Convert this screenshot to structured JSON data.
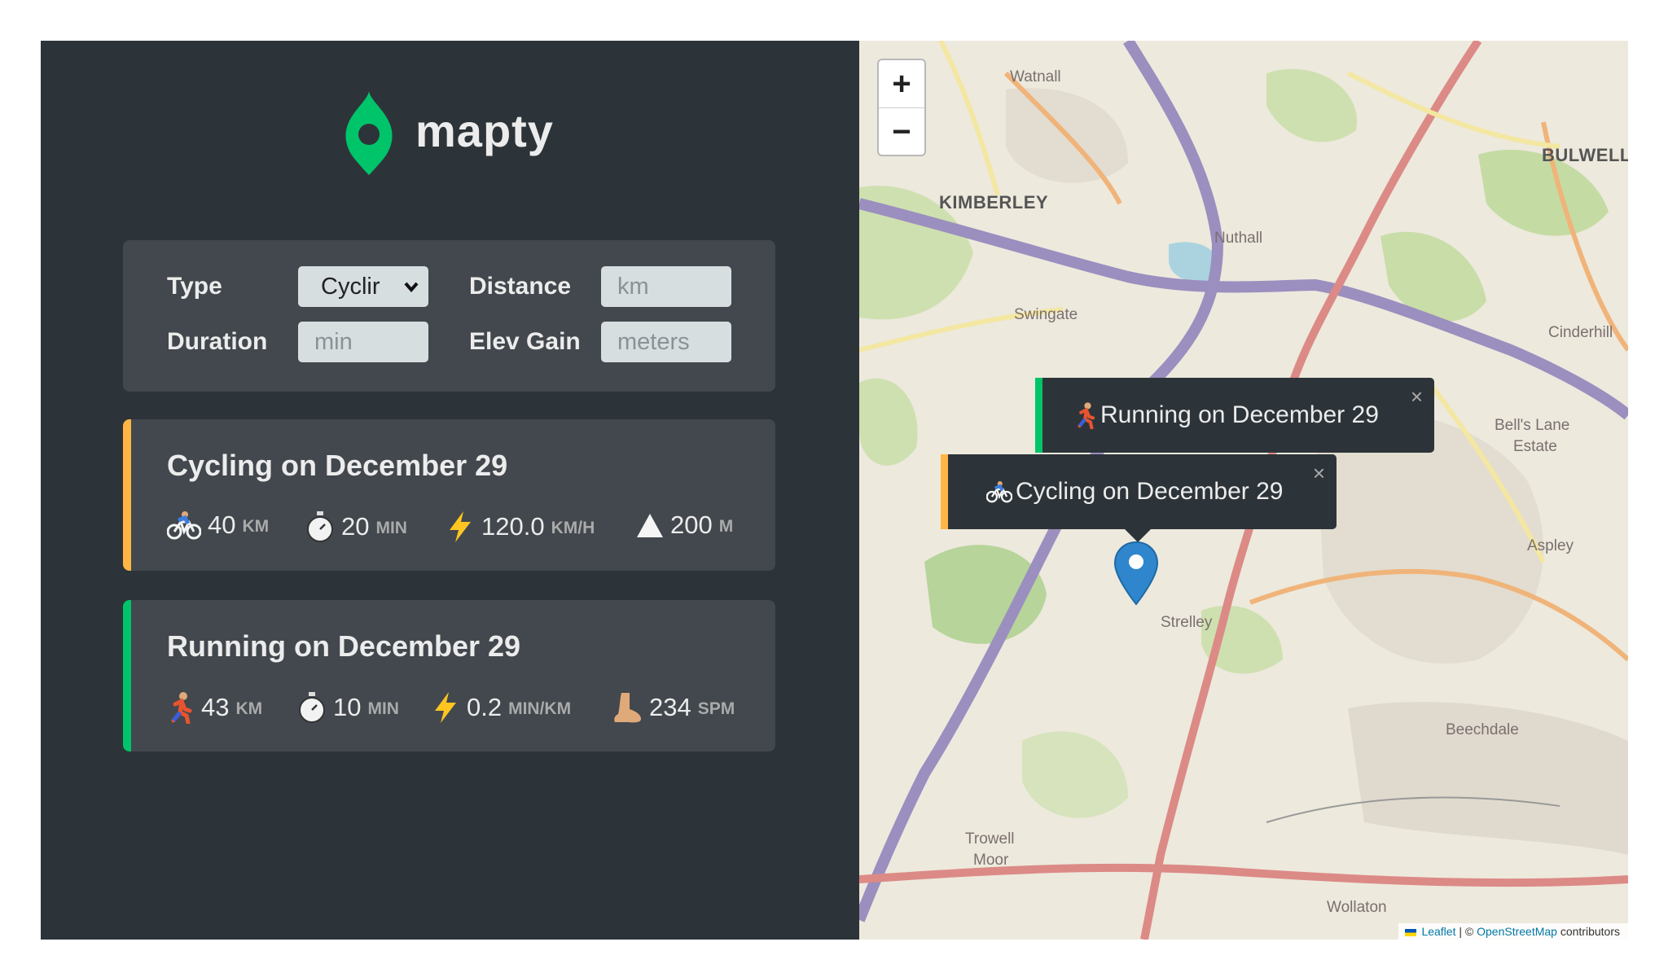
{
  "app": {
    "logo_text": "mapty"
  },
  "form": {
    "type_label": "Type",
    "type_value": "Cyclir",
    "distance_label": "Distance",
    "distance_placeholder": "km",
    "duration_label": "Duration",
    "duration_placeholder": "min",
    "elev_label": "Elev Gain",
    "elev_placeholder": "meters"
  },
  "workouts": [
    {
      "title": "Cycling on December 29",
      "accent": "#ffb545",
      "stats": [
        {
          "icon": "bicycle-icon",
          "value": "40",
          "unit": "km"
        },
        {
          "icon": "stopwatch-icon",
          "value": "20",
          "unit": "min"
        },
        {
          "icon": "lightning-icon",
          "value": "120.0",
          "unit": "km/h"
        },
        {
          "icon": "mountain-icon",
          "value": "200",
          "unit": "m"
        }
      ]
    },
    {
      "title": "Running on December 29",
      "accent": "#00c46a",
      "stats": [
        {
          "icon": "runner-icon",
          "value": "43",
          "unit": "km"
        },
        {
          "icon": "stopwatch-icon",
          "value": "10",
          "unit": "min"
        },
        {
          "icon": "lightning-icon",
          "value": "0.2",
          "unit": "min/km"
        },
        {
          "icon": "foot-icon",
          "value": "234",
          "unit": "spm"
        }
      ]
    }
  ],
  "map": {
    "zoom_in": "+",
    "zoom_out": "−",
    "popups": [
      {
        "text": "Running on December 29",
        "accent": "#00c46a",
        "close": "×"
      },
      {
        "text": "Cycling on December 29",
        "accent": "#ffb545",
        "close": "×"
      }
    ],
    "places": [
      "Watnall",
      "BULWELL",
      "KIMBERLEY",
      "Nuthall",
      "Swingate",
      "Cinderhill",
      "Bell's Lane",
      "Estate",
      "Aspley",
      "Strelley",
      "Beechdale",
      "Trowell",
      "Moor",
      "Wollaton"
    ],
    "attribution": {
      "leaflet": "Leaflet",
      "sep": " | © ",
      "osm": "OpenStreetMap",
      "rest": " contributors"
    }
  },
  "colors": {
    "sidebar": "#2d3439",
    "card": "#42484d",
    "brand": "#00c46a",
    "cycling": "#ffb545",
    "running": "#00c46a"
  }
}
